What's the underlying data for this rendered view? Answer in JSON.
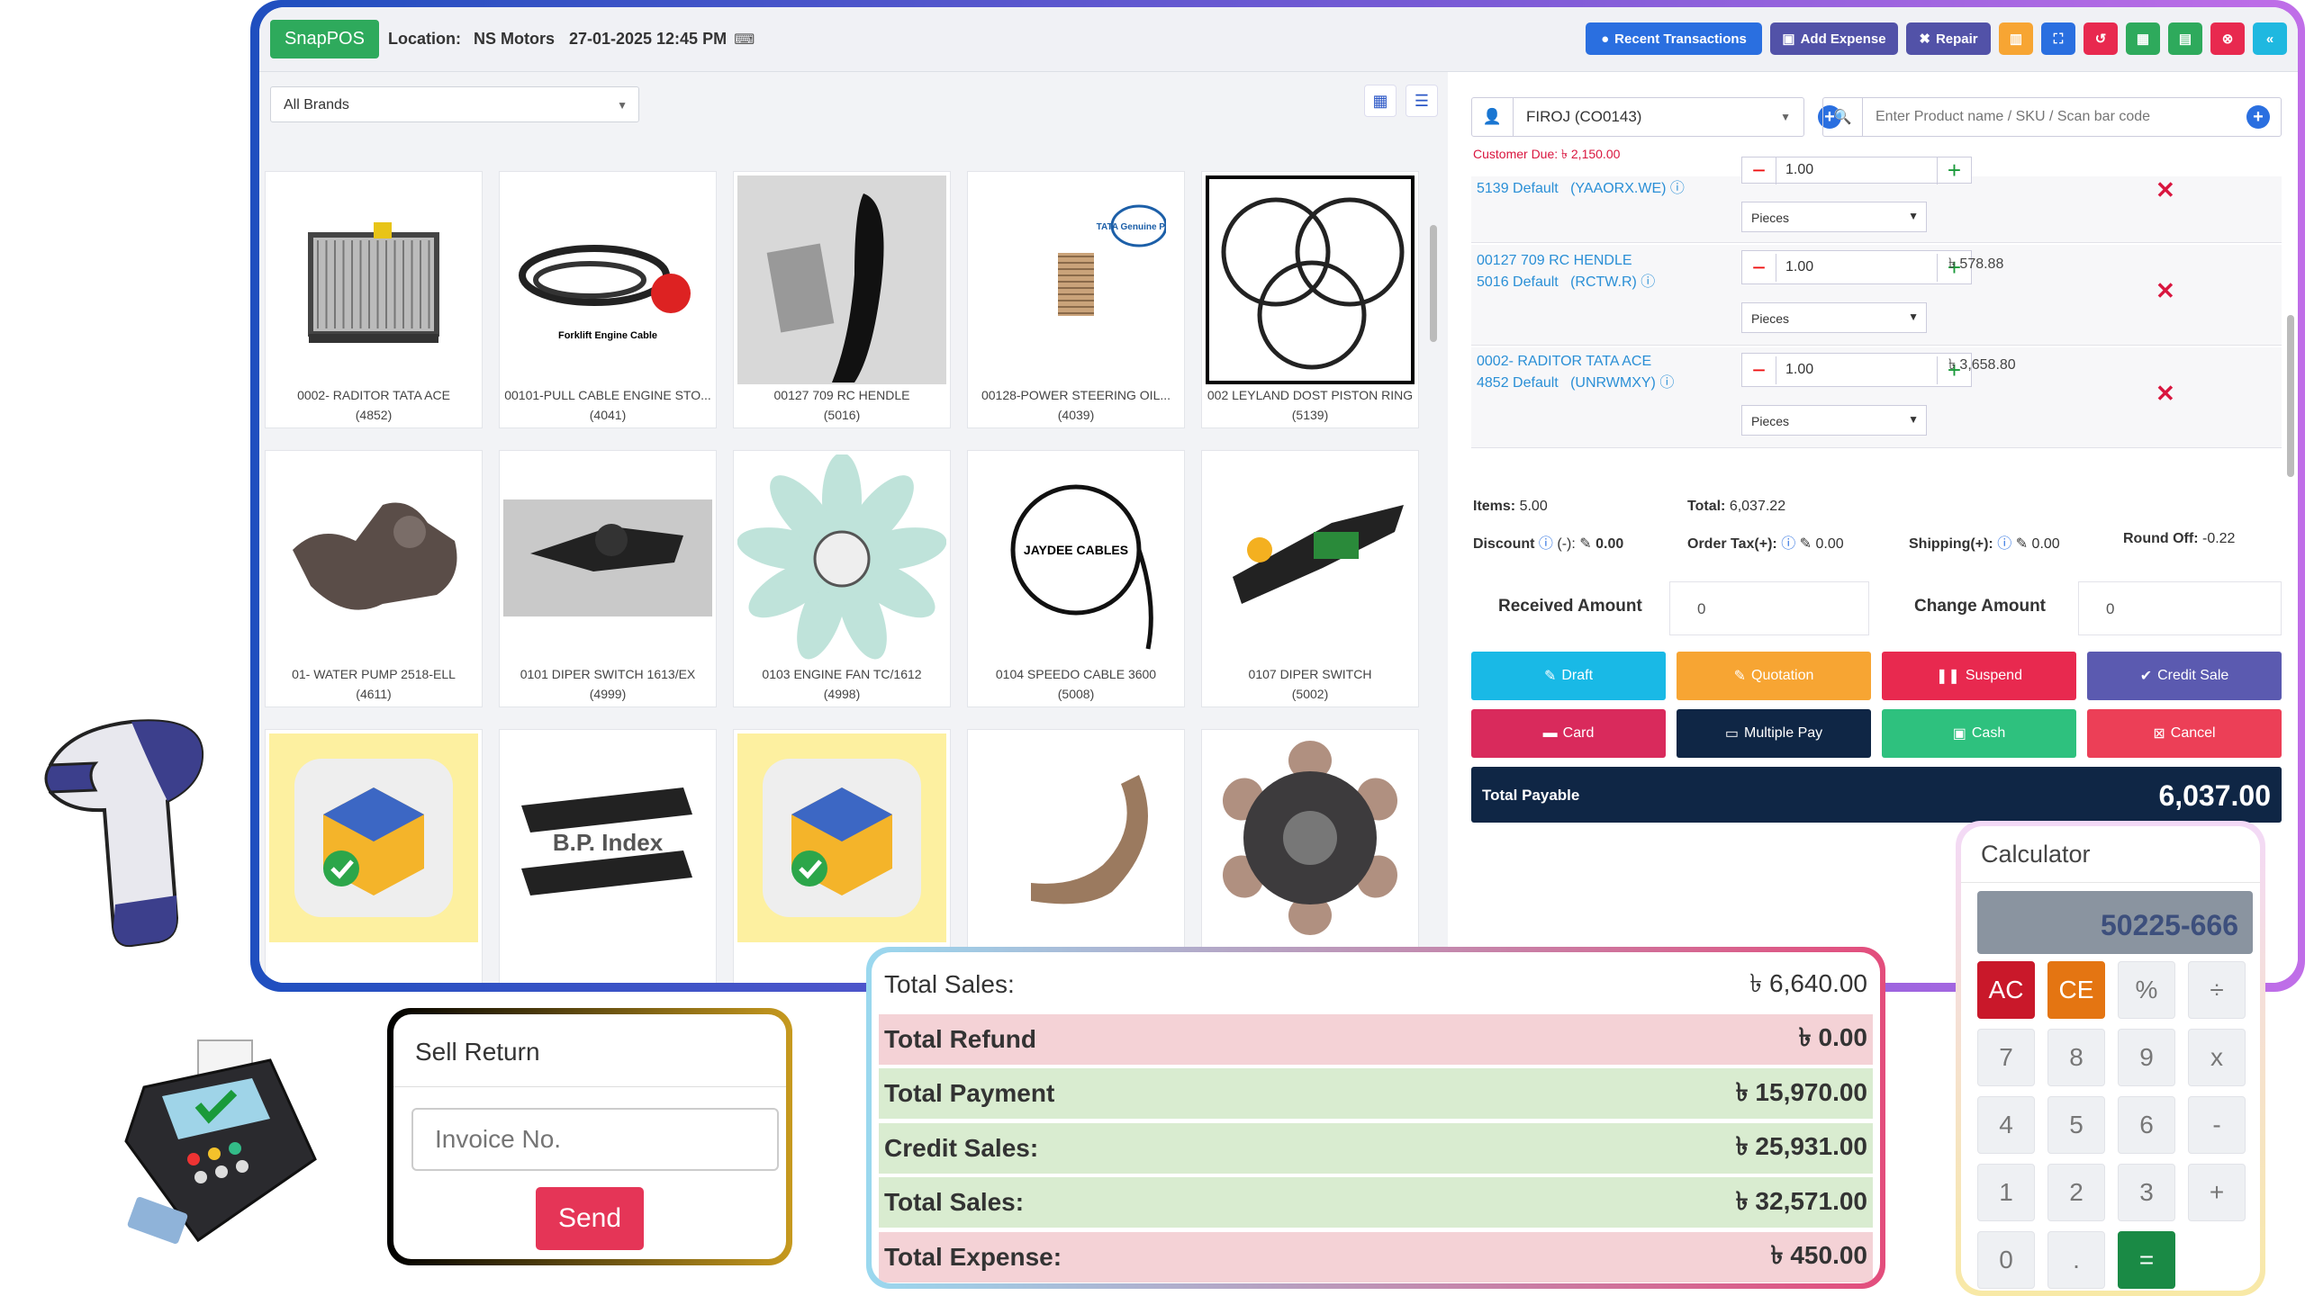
{
  "header": {
    "brand": "SnapPOS",
    "location_label": "Location:",
    "location": "NS Motors",
    "datetime": "27-01-2025 12:45 PM",
    "buttons": {
      "recent_transactions": "Recent Transactions",
      "add_expense": "Add Expense",
      "repair": "Repair"
    },
    "icon_buttons": [
      "chart-icon",
      "fullscreen-icon",
      "undo-icon",
      "calculator-icon",
      "document-icon",
      "close-circle-icon",
      "double-chevron-left-icon"
    ]
  },
  "products": {
    "brand_filter": "All Brands",
    "items": [
      {
        "name": "0002- RADITOR TATA ACE",
        "code": "(4852)"
      },
      {
        "name": "00101-PULL CABLE ENGINE STO...",
        "code": "(4041)"
      },
      {
        "name": "00127 709 RC HENDLE",
        "code": "(5016)"
      },
      {
        "name": "00128-POWER STEERING OIL...",
        "code": "(4039)"
      },
      {
        "name": "002 LEYLAND DOST PISTON RING",
        "code": "(5139)"
      },
      {
        "name": "01- WATER PUMP 2518-ELL",
        "code": "(4611)"
      },
      {
        "name": "0101 DIPER SWITCH 1613/EX",
        "code": "(4999)"
      },
      {
        "name": "0103 ENGINE FAN TC/1612",
        "code": "(4998)"
      },
      {
        "name": "0104 SPEEDO CABLE 3600",
        "code": "(5008)"
      },
      {
        "name": "0107 DIPER SWITCH",
        "code": "(5002)"
      },
      {
        "name": "",
        "code": ""
      },
      {
        "name": "",
        "code": ""
      },
      {
        "name": "",
        "code": ""
      },
      {
        "name": "",
        "code": ""
      },
      {
        "name": "",
        "code": ""
      }
    ],
    "image_labels": {
      "cable": "Forklift Engine Cable",
      "tata": "TATA Genuine Parts",
      "jaydee": "JAYDEE CABLES",
      "bp": "B.P. Index"
    }
  },
  "cart": {
    "customer": "FIROJ (CO0143)",
    "search_placeholder": "Enter Product name / SKU / Scan bar code",
    "customer_due": "Customer Due: ৳ 2,150.00",
    "items": [
      {
        "line1": "5139 Default",
        "sku": "(YAAORX.WE)",
        "line2": "",
        "qty": "1.00",
        "unit": "Pieces",
        "price": ""
      },
      {
        "line1": "00127 709 RC HENDLE",
        "line2": "5016 Default",
        "sku": "(RCTW.R)",
        "qty": "1.00",
        "unit": "Pieces",
        "price": "৳ 578.88"
      },
      {
        "line1": "0002- RADITOR TATA ACE",
        "line2": "4852 Default",
        "sku": "(UNRWMXY)",
        "qty": "1.00",
        "unit": "Pieces",
        "price": "৳ 3,658.80"
      }
    ],
    "summary": {
      "items_label": "Items:",
      "items": "5.00",
      "total_label": "Total:",
      "total": "6,037.22",
      "discount_label": "Discount",
      "discount_sign": "(-):",
      "discount": "0.00",
      "tax_label": "Order Tax(+):",
      "tax": "0.00",
      "shipping_label": "Shipping(+):",
      "shipping": "0.00",
      "round_label": "Round Off:",
      "round": "-0.22"
    },
    "received_label": "Received Amount",
    "received": "0",
    "change_label": "Change Amount",
    "change": "0",
    "actions": {
      "draft": "Draft",
      "quotation": "Quotation",
      "suspend": "Suspend",
      "credit": "Credit Sale",
      "card": "Card",
      "multipay": "Multiple Pay",
      "cash": "Cash",
      "cancel": "Cancel"
    },
    "total_payable_label": "Total Payable",
    "total_payable": "6,037.00"
  },
  "sell_return": {
    "title": "Sell Return",
    "placeholder": "Invoice No.",
    "send": "Send"
  },
  "sales_summary": [
    {
      "label": "Total Sales:",
      "value": "৳ 6,640.00"
    },
    {
      "label": "Total Refund",
      "value": "৳ 0.00"
    },
    {
      "label": "Total Payment",
      "value": "৳ 15,970.00"
    },
    {
      "label": "Credit Sales:",
      "value": "৳ 25,931.00"
    },
    {
      "label": "Total Sales:",
      "value": "৳ 32,571.00"
    },
    {
      "label": "Total Expense:",
      "value": "৳ 450.00"
    }
  ],
  "calculator": {
    "title": "Calculator",
    "display": "50225-666",
    "keys": [
      "AC",
      "CE",
      "%",
      "÷",
      "7",
      "8",
      "9",
      "x",
      "4",
      "5",
      "6",
      "-",
      "1",
      "2",
      "3",
      "+",
      "0",
      ".",
      "="
    ]
  },
  "colors": {
    "brand_green": "#2eaa5c",
    "primary_blue": "#2a6fe0",
    "danger": "#d9163f",
    "total_bar": "#0f2645"
  }
}
